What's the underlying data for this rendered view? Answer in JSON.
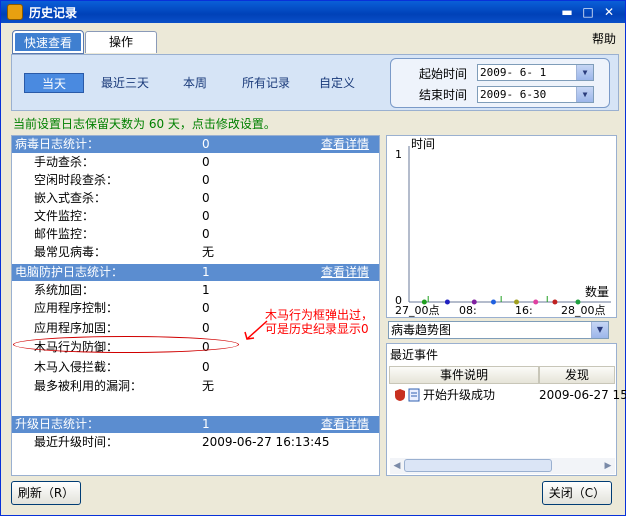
{
  "window": {
    "title": "历史记录"
  },
  "help_label": "帮助",
  "tabs": [
    {
      "label": "快速查看"
    },
    {
      "label": "操作"
    }
  ],
  "ranges": [
    {
      "label": "当天"
    },
    {
      "label": "最近三天"
    },
    {
      "label": "本周"
    },
    {
      "label": "所有记录"
    },
    {
      "label": "自定义"
    }
  ],
  "dates": {
    "start_label": "起始时间",
    "start_value": "2009- 6- 1",
    "end_label": "结束时间",
    "end_value": "2009- 6-30"
  },
  "notice": "当前设置日志保留天数为 60 天，点击修改设置。",
  "virus_log": {
    "title": "病毒日志统计：",
    "value": "0",
    "link": "查看详情",
    "rows": [
      {
        "label": "手动查杀：",
        "value": "0"
      },
      {
        "label": "空闲时段查杀：",
        "value": "0"
      },
      {
        "label": "嵌入式查杀：",
        "value": "0"
      },
      {
        "label": "文件监控：",
        "value": "0"
      },
      {
        "label": "邮件监控：",
        "value": "0"
      },
      {
        "label": "最常见病毒：",
        "value": "无"
      }
    ]
  },
  "protect_log": {
    "title": "电脑防护日志统计：",
    "value": "1",
    "link": "查看详情",
    "rows": [
      {
        "label": "系统加固：",
        "value": "1"
      },
      {
        "label": "应用程序控制：",
        "value": "0"
      },
      {
        "label": "应用程序加固：",
        "value": "0"
      },
      {
        "label": "木马行为防御：",
        "value": "0"
      },
      {
        "label": "木马入侵拦截：",
        "value": "0"
      },
      {
        "label": "最多被利用的漏洞：",
        "value": "无"
      }
    ]
  },
  "upgrade_log": {
    "title": "升级日志统计：",
    "value": "1",
    "link": "查看详情",
    "rows": [
      {
        "label": "最近升级时间：",
        "value": "2009-06-27 16:13:45"
      }
    ]
  },
  "annotation": {
    "line1": "木马行为框弹出过，",
    "line2": "可是历史纪录显示0"
  },
  "chart_data": {
    "type": "scatter",
    "ylabel": "时间",
    "xlabel": "数量",
    "y_ticks": [
      "1",
      "0"
    ],
    "x_tick_labels": [
      "27_00点",
      "08:",
      "16:",
      "28_00点"
    ],
    "points": [
      {
        "x": 0.08,
        "y": 0,
        "color": "#20a020"
      },
      {
        "x": 0.2,
        "y": 0,
        "color": "#2020c0"
      },
      {
        "x": 0.34,
        "y": 0,
        "color": "#8020a0"
      },
      {
        "x": 0.44,
        "y": 0,
        "color": "#2060e0"
      },
      {
        "x": 0.56,
        "y": 0,
        "color": "#a0a020"
      },
      {
        "x": 0.66,
        "y": 0,
        "color": "#e040a0"
      },
      {
        "x": 0.76,
        "y": 0,
        "color": "#c02020"
      },
      {
        "x": 0.88,
        "y": 0,
        "color": "#20a040"
      }
    ],
    "spikes": [
      0.1,
      0.48,
      0.72
    ]
  },
  "chart_selector": {
    "value": "病毒趋势图"
  },
  "events": {
    "title": "最近事件",
    "columns": [
      {
        "label": "事件说明"
      },
      {
        "label": "发现"
      }
    ],
    "rows": [
      {
        "desc": "开始升级成功",
        "time": "2009-06-27 15"
      }
    ]
  },
  "buttons": {
    "refresh": "刷新（R）",
    "close": "关闭（C）"
  }
}
